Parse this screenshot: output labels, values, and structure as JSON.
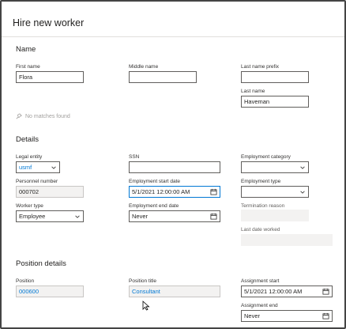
{
  "dialog": {
    "title": "Hire new worker"
  },
  "name_section": {
    "heading": "Name",
    "first_name": {
      "label": "First name",
      "value": "Flora"
    },
    "middle_name": {
      "label": "Middle name",
      "value": ""
    },
    "last_name_prefix": {
      "label": "Last name prefix",
      "value": ""
    },
    "last_name": {
      "label": "Last name",
      "value": "Haveman"
    },
    "no_matches": "No matches found"
  },
  "details_section": {
    "heading": "Details",
    "legal_entity": {
      "label": "Legal entity",
      "value": "usmf"
    },
    "ssn": {
      "label": "SSN",
      "value": ""
    },
    "employment_category": {
      "label": "Employment category",
      "value": ""
    },
    "personnel_number": {
      "label": "Personnel number",
      "value": "000702"
    },
    "employment_start_date": {
      "label": "Employment start date",
      "value": "5/1/2021 12:00:00 AM"
    },
    "employment_type": {
      "label": "Employment type",
      "value": ""
    },
    "worker_type": {
      "label": "Worker type",
      "value": "Employee"
    },
    "employment_end_date": {
      "label": "Employment end date",
      "value": "Never"
    },
    "termination_reason": {
      "label": "Termination reason",
      "value": ""
    },
    "last_date_worked": {
      "label": "Last date worked",
      "value": ""
    }
  },
  "position_section": {
    "heading": "Position details",
    "position": {
      "label": "Position",
      "value": "000600"
    },
    "position_title": {
      "label": "Position title",
      "value": "Consultant"
    },
    "assignment_start": {
      "label": "Assignment start",
      "value": "5/1/2021 12:00:00 AM"
    },
    "assignment_end": {
      "label": "Assignment end",
      "value": "Never"
    }
  },
  "colors": {
    "accent": "#0078d4",
    "readonly_bg": "#f3f2f1",
    "border": "#605e5c"
  },
  "icons": [
    "chevron-down-icon",
    "calendar-icon",
    "pin-icon",
    "mouse-cursor-icon"
  ]
}
